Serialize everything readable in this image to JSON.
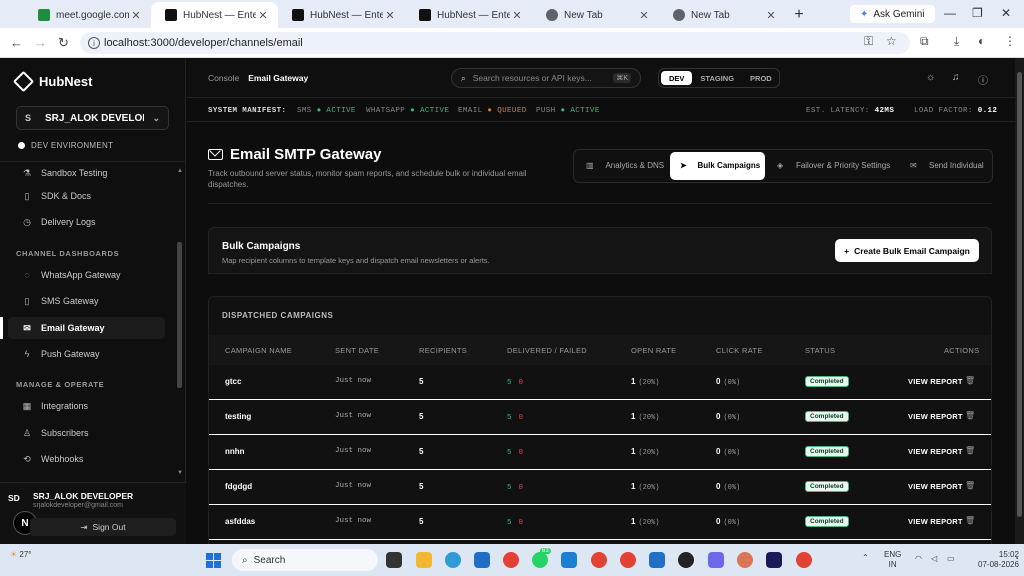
{
  "browser": {
    "tabs": [
      {
        "title": "meet.google.com",
        "color": "#1e8e3e"
      },
      {
        "title": "HubNest — Enterprise",
        "color": "#111111"
      },
      {
        "title": "HubNest — Enterprise",
        "color": "#111111"
      },
      {
        "title": "HubNest — Enterprise",
        "color": "#111111"
      },
      {
        "title": "New Tab",
        "color": "#5f6368"
      },
      {
        "title": "New Tab",
        "color": "#5f6368"
      }
    ],
    "new_tab": "+",
    "gemini": "Ask Gemini",
    "url": "localhost:3000/developer/channels/email"
  },
  "sidebar": {
    "brand": "HubNest",
    "project_initial": "S",
    "project_name": "SRJ_ALOK DEVELOP...",
    "environment": "DEV ENVIRONMENT",
    "items_top": [
      {
        "label": "Sandbox Testing",
        "icon": "flask-icon"
      },
      {
        "label": "SDK & Docs",
        "icon": "book-icon"
      },
      {
        "label": "Delivery Logs",
        "icon": "log-icon"
      }
    ],
    "section_channels": "CHANNEL DASHBOARDS",
    "channels": [
      {
        "label": "WhatsApp Gateway",
        "icon": "chat-icon"
      },
      {
        "label": "SMS Gateway",
        "icon": "phone-icon"
      },
      {
        "label": "Email Gateway",
        "icon": "mail-icon",
        "active": true
      },
      {
        "label": "Push Gateway",
        "icon": "bolt-icon"
      }
    ],
    "section_manage": "MANAGE & OPERATE",
    "manage": [
      {
        "label": "Integrations",
        "icon": "grid-icon"
      },
      {
        "label": "Subscribers",
        "icon": "user-icon"
      },
      {
        "label": "Webhooks",
        "icon": "webhook-icon"
      }
    ],
    "user_initials": "SD",
    "user_name": "SRJ_ALOK DEVELOPER",
    "user_email": "srjalokdeveloper@gmail.com",
    "badge_letter": "N",
    "sign_out": "Sign Out"
  },
  "header": {
    "crumb_root": "Console",
    "crumb_current": "Email Gateway",
    "search_placeholder": "Search resources or API keys...",
    "search_kbd": "⌘K",
    "envs": [
      "DEV",
      "STAGING",
      "PROD"
    ],
    "active_env": "DEV"
  },
  "manifest": {
    "label": "SYSTEM MANIFEST:",
    "sms": "SMS",
    "sms_status": "ACTIVE",
    "whatsapp": "WHATSAPP",
    "whatsapp_status": "ACTIVE",
    "email": "EMAIL",
    "email_status": "QUEUED",
    "push": "PUSH",
    "push_status": "ACTIVE",
    "latency_label": "EST. LATENCY:",
    "latency": "42MS",
    "load_label": "LOAD FACTOR:",
    "load": "0.12"
  },
  "page": {
    "title": "Email SMTP Gateway",
    "subtitle": "Track outbound server status, monitor spam reports, and schedule bulk or individual email dispatches.",
    "tabs": [
      {
        "label": "Analytics & DNS",
        "icon": "chart-icon"
      },
      {
        "label": "Bulk Campaigns",
        "icon": "send-icon",
        "active": true
      },
      {
        "label": "Failover & Priority Settings",
        "icon": "layers-icon"
      },
      {
        "label": "Send Individual",
        "icon": "mail-icon"
      }
    ]
  },
  "bulk": {
    "title": "Bulk Campaigns",
    "subtitle": "Map recipient columns to template keys and dispatch email newsletters or alerts.",
    "create_button": "Create Bulk Email Campaign"
  },
  "campaigns": {
    "title": "DISPATCHED CAMPAIGNS",
    "columns": [
      "CAMPAIGN NAME",
      "SENT DATE",
      "RECIPIENTS",
      "DELIVERED / FAILED",
      "OPEN RATE",
      "CLICK RATE",
      "STATUS",
      "ACTIONS"
    ],
    "rows": [
      {
        "name": "gtcc",
        "date": "Just now",
        "recipients": "5",
        "delivered": "5",
        "failed": "0",
        "open": "1",
        "open_pct": "(20%)",
        "click": "0",
        "click_pct": "(0%)",
        "status": "Completed",
        "action": "VIEW REPORT"
      },
      {
        "name": "testing",
        "date": "Just now",
        "recipients": "5",
        "delivered": "5",
        "failed": "0",
        "open": "1",
        "open_pct": "(20%)",
        "click": "0",
        "click_pct": "(0%)",
        "status": "Completed",
        "action": "VIEW REPORT"
      },
      {
        "name": "nnhn",
        "date": "Just now",
        "recipients": "5",
        "delivered": "5",
        "failed": "0",
        "open": "1",
        "open_pct": "(20%)",
        "click": "0",
        "click_pct": "(0%)",
        "status": "Completed",
        "action": "VIEW REPORT"
      },
      {
        "name": "fdgdgd",
        "date": "Just now",
        "recipients": "5",
        "delivered": "5",
        "failed": "0",
        "open": "1",
        "open_pct": "(20%)",
        "click": "0",
        "click_pct": "(0%)",
        "status": "Completed",
        "action": "VIEW REPORT"
      },
      {
        "name": "asfddas",
        "date": "Just now",
        "recipients": "5",
        "delivered": "5",
        "failed": "0",
        "open": "1",
        "open_pct": "(20%)",
        "click": "0",
        "click_pct": "(0%)",
        "status": "Completed",
        "action": "VIEW REPORT"
      }
    ]
  },
  "taskbar": {
    "weather": "27°",
    "search": "Search",
    "whatsapp_badge": "63",
    "lang": "ENG",
    "region": "IN",
    "time": "15:02",
    "date": "07-08-2026"
  }
}
